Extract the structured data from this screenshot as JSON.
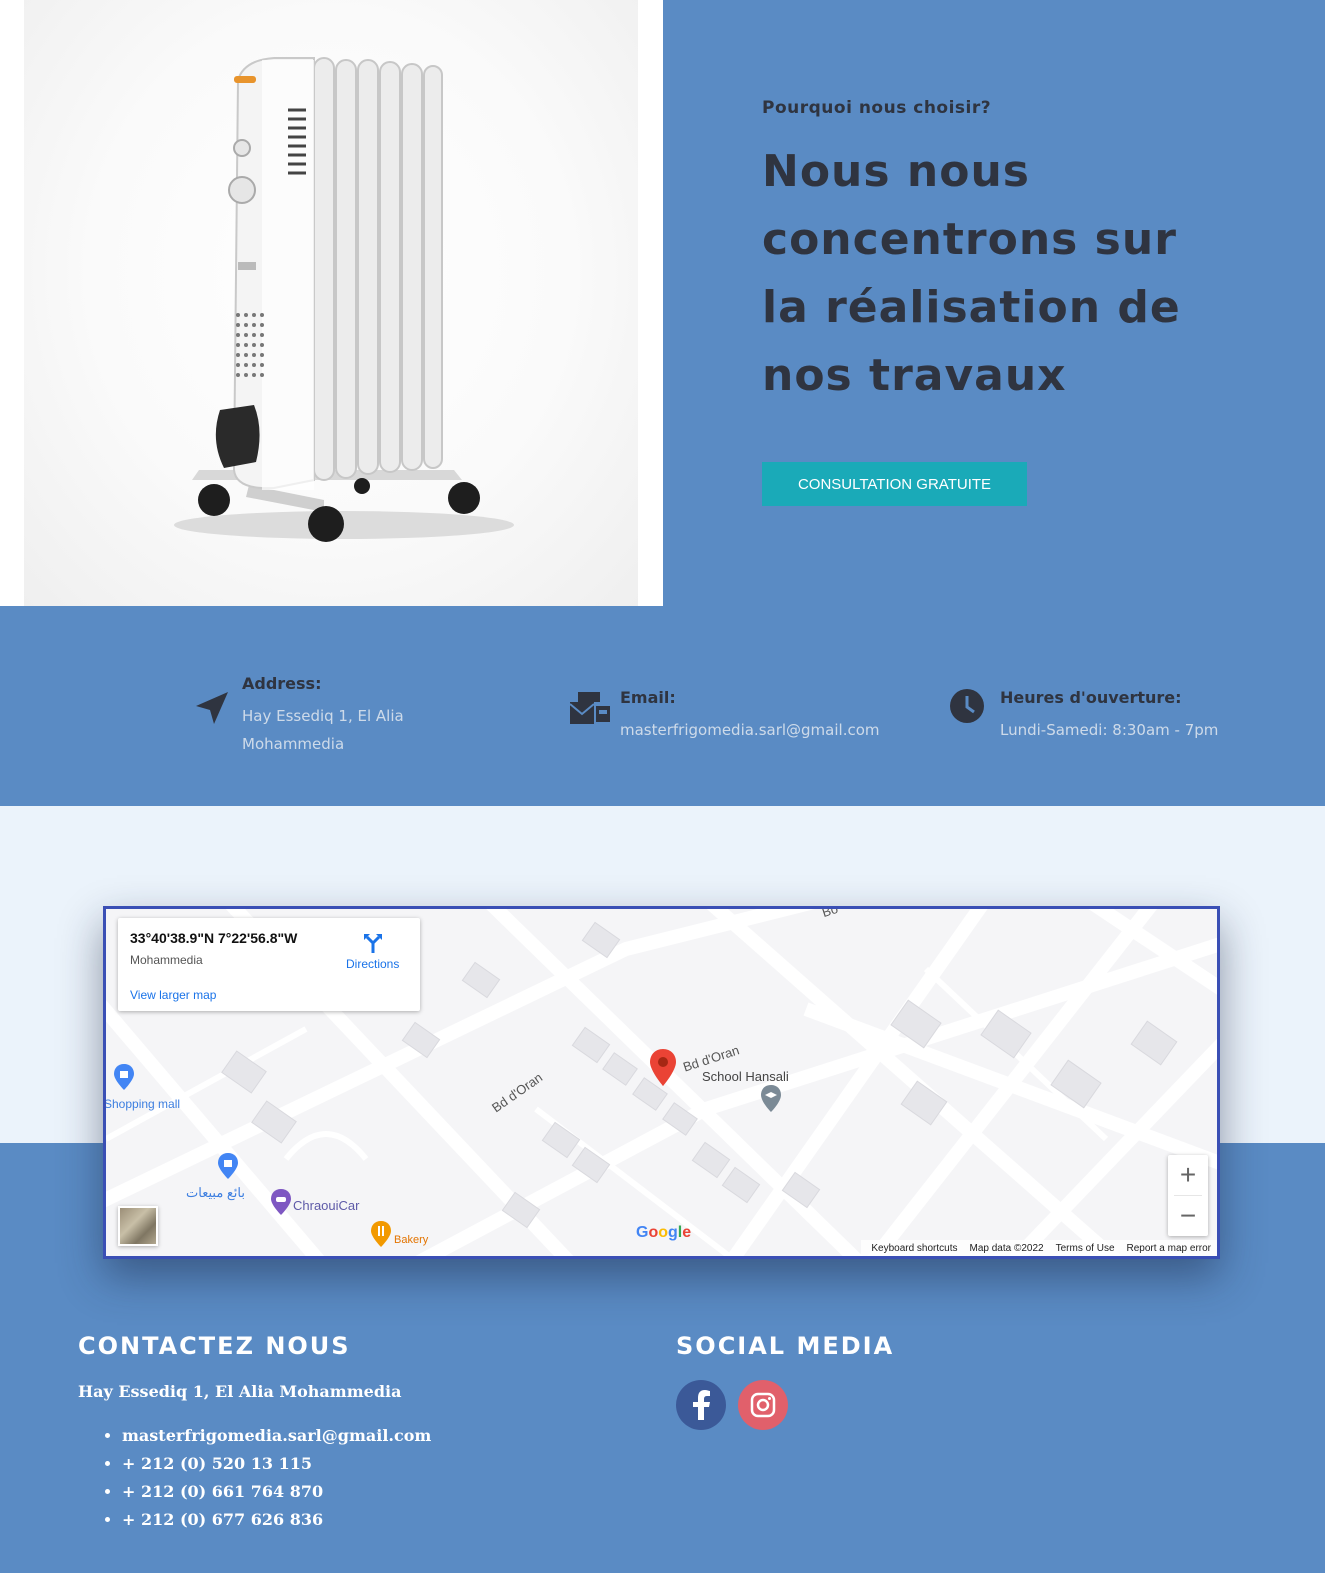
{
  "hero": {
    "kicker": "Pourquoi nous choisir?",
    "title": "Nous nous concentrons sur la réalisation de nos travaux",
    "cta_label": "CONSULTATION GRATUITE"
  },
  "info": {
    "address_label": "Address:",
    "address_line1": "Hay Essediq 1, El Alia",
    "address_line2": "Mohammedia",
    "email_label": "Email:",
    "email_value": "masterfrigomedia.sarl@gmail.com",
    "hours_label": "Heures d'ouverture:",
    "hours_value": "Lundi-Samedi: 8:30am - 7pm"
  },
  "map": {
    "coords": "33°40'38.9\"N 7°22'56.8\"W",
    "place": "Mohammedia",
    "directions": "Directions",
    "view_larger": "View larger map",
    "street_1": "Bd d'Oran",
    "street_2": "Bd d'Oran",
    "street_3": "Bo",
    "poi_school": "School Hansali",
    "poi_mall": "Shopping mall",
    "poi_arabic": "بائع مبيعات",
    "poi_chraoui": "ChraouiCar",
    "poi_bakery": "Bakery",
    "google": "Google",
    "attr_shortcuts": "Keyboard shortcuts",
    "attr_data": "Map data ©2022",
    "attr_terms": "Terms of Use",
    "attr_report": "Report a map error",
    "zoom_in": "+",
    "zoom_out": "−"
  },
  "footer": {
    "contact_heading": "CONTACTEZ NOUS",
    "contact_address": "Hay Essediq 1, El Alia Mohammedia",
    "contact_items": [
      "masterfrigomedia.sarl@gmail.com",
      "+ 212 (0) 520 13 115",
      "+ 212 (0) 661 764 870",
      "+ 212 (0) 677 626 836"
    ],
    "social_heading": "SOCIAL MEDIA"
  },
  "colors": {
    "brand_blue": "#5a8bc4",
    "cta_teal": "#1aaab8",
    "facebook": "#3b5998",
    "instagram": "#e1606b"
  },
  "icons": [
    "navigation-arrow-icon",
    "email-envelope-icon",
    "clock-icon",
    "directions-icon",
    "map-pin-icon",
    "facebook-icon",
    "instagram-icon"
  ]
}
